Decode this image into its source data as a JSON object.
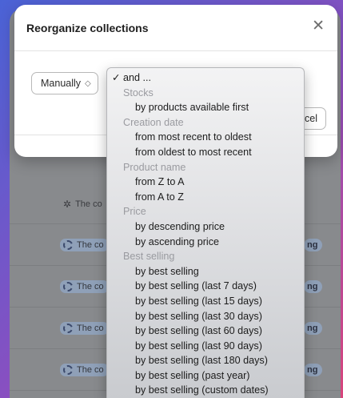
{
  "modal": {
    "title": "Reorganize collections",
    "close_icon": "close-icon",
    "sort_select_label": "Manually",
    "sort_select_chevron": "◇",
    "cancel_label_partial": "cel"
  },
  "background_rows": [
    {
      "label": "The co",
      "icon": "sparkle-icon",
      "pill": ""
    },
    {
      "label": "The co",
      "icon": "gear-icon",
      "pill": "ng"
    },
    {
      "label": "The co",
      "icon": "gear-icon",
      "pill": "ng"
    },
    {
      "label": "The co",
      "icon": "gear-icon",
      "pill": "ng"
    },
    {
      "label": "The co",
      "icon": "gear-icon",
      "pill": "ng"
    }
  ],
  "menu": {
    "selected": "✓ and ...",
    "groups": [
      {
        "heading": "Stocks",
        "items": [
          "by products available first"
        ]
      },
      {
        "heading": "Creation date",
        "items": [
          "from most recent to oldest",
          "from oldest to most recent"
        ]
      },
      {
        "heading": "Product name",
        "items": [
          "from Z to A",
          "from A to Z"
        ]
      },
      {
        "heading": "Price",
        "items": [
          "by descending price",
          "by ascending price"
        ]
      },
      {
        "heading": "Best selling",
        "items": [
          "by best selling",
          "by best selling (last 7 days)",
          "by best selling (last 15 days)",
          "by best selling (last 30 days)",
          "by best selling (last 60 days)",
          "by best selling (last 90 days)",
          "by best selling (last 180 days)",
          "by best selling (past year)",
          "by best selling (custom dates)"
        ]
      }
    ]
  }
}
